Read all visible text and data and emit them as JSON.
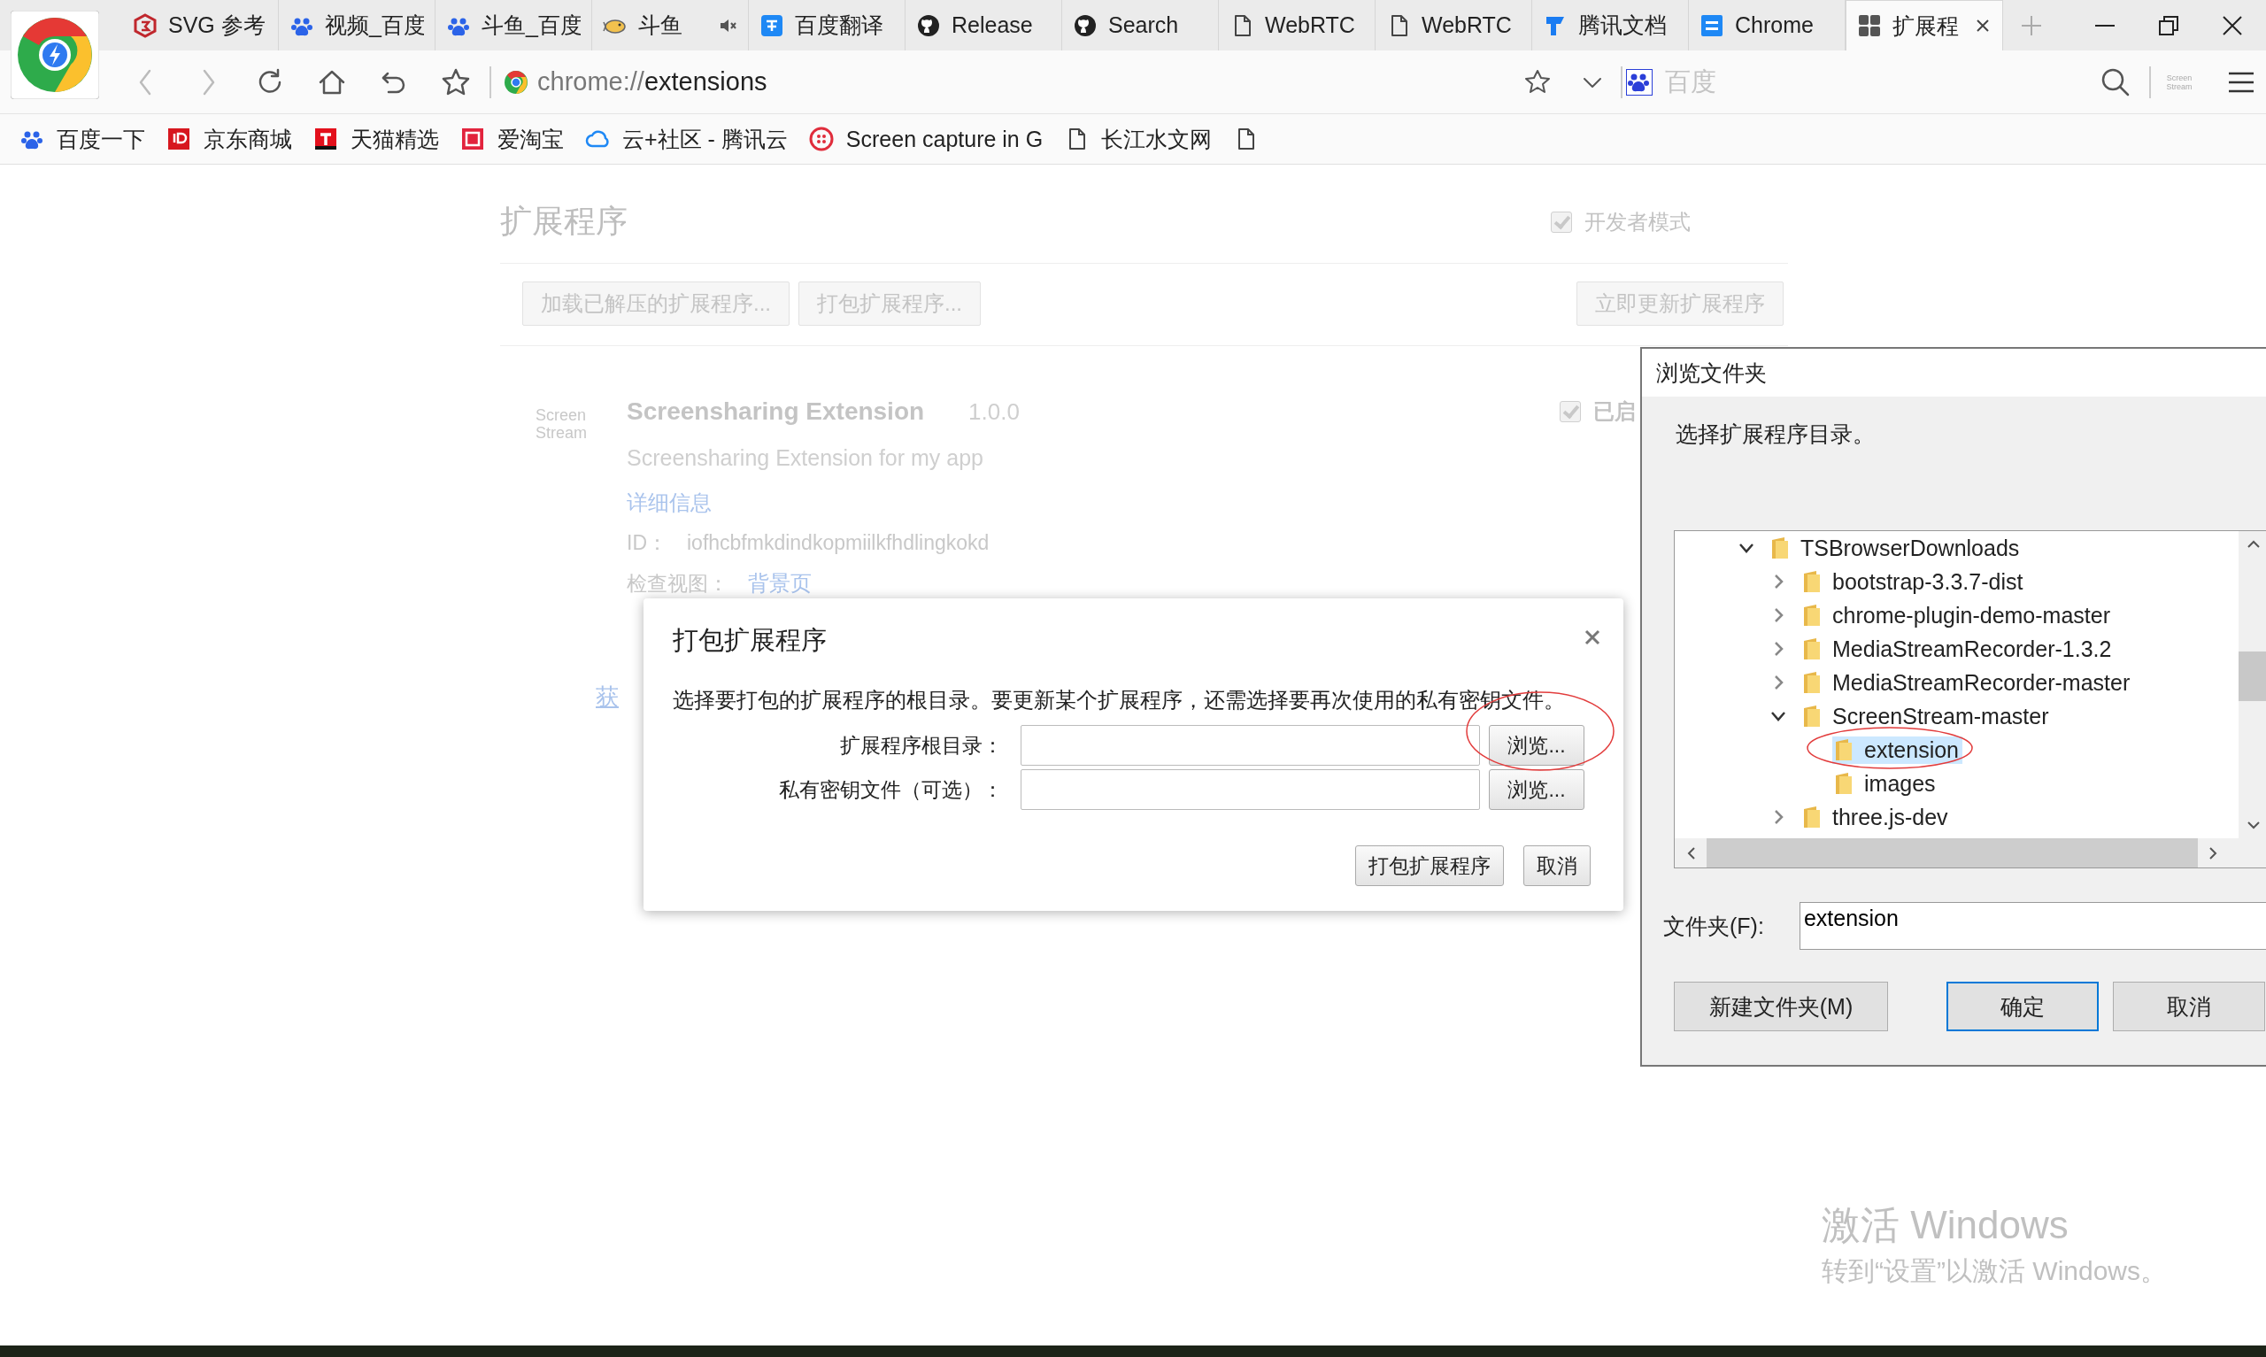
{
  "browser": {
    "tabs": [
      {
        "label": "SVG 参考",
        "selected": false,
        "muted": false
      },
      {
        "label": "视频_百度",
        "selected": false,
        "muted": false
      },
      {
        "label": "斗鱼_百度",
        "selected": false,
        "muted": false
      },
      {
        "label": "斗鱼",
        "selected": false,
        "muted": true
      },
      {
        "label": "百度翻译",
        "selected": false,
        "muted": false
      },
      {
        "label": "Release",
        "selected": false,
        "muted": false
      },
      {
        "label": "Search",
        "selected": false,
        "muted": false
      },
      {
        "label": "WebRTC",
        "selected": false,
        "muted": false
      },
      {
        "label": "WebRTC",
        "selected": false,
        "muted": false
      },
      {
        "label": "腾讯文档",
        "selected": false,
        "muted": false
      },
      {
        "label": "Chrome",
        "selected": false,
        "muted": false
      },
      {
        "label": "扩展程",
        "selected": true,
        "muted": false
      }
    ],
    "address": "chrome://extensions",
    "search": {
      "placeholder": "百度"
    },
    "toolbar_extension": {
      "label": "Screen Stream"
    },
    "bookmarks": [
      "百度一下",
      "京东商城",
      "天猫精选",
      "爱淘宝",
      "云+社区 - 腾讯云",
      "Screen capture in G",
      "长江水文网"
    ]
  },
  "extensions_page": {
    "title": "扩展程序",
    "developer_mode": {
      "label": "开发者模式",
      "checked": true
    },
    "buttons": [
      "加载已解压的扩展程序...",
      "打包扩展程序..."
    ],
    "update_button": "立即更新扩展程序",
    "extensions": [
      {
        "icon_text": "Screen Stream",
        "name": "Screensharing Extension",
        "version": "1.0.0",
        "description": "Screensharing Extension for my app",
        "details_link": "详细信息",
        "id_label": "ID：",
        "id": "iofhcbfmkdindkopmiilkfhdlingkokd",
        "views_label": "检查视图：",
        "views_link": "背景页",
        "enabled": {
          "label": "已启",
          "checked": true
        }
      }
    ],
    "footer_link": "获"
  },
  "pack_dialog": {
    "title": "打包扩展程序",
    "description": "选择要打包的扩展程序的根目录。要更新某个扩展程序，还需选择要再次使用的私有密钥文件。",
    "fields": [
      {
        "label": "扩展程序根目录：",
        "button": "浏览..."
      },
      {
        "label": "私有密钥文件（可选）：",
        "button": "浏览..."
      }
    ],
    "buttons": [
      "打包扩展程序",
      "取消"
    ]
  },
  "folder_dialog": {
    "title": "浏览文件夹",
    "prompt": "选择扩展程序目录。",
    "tree": [
      {
        "label": "TSBrowserDownloads",
        "expanded": true,
        "selected": false,
        "children": [
          {
            "label": "bootstrap-3.3.7-dist",
            "expanded": false,
            "selected": false
          },
          {
            "label": "chrome-plugin-demo-master",
            "expanded": false,
            "selected": false
          },
          {
            "label": "MediaStreamRecorder-1.3.2",
            "expanded": false,
            "selected": false
          },
          {
            "label": "MediaStreamRecorder-master",
            "expanded": false,
            "selected": false
          },
          {
            "label": "ScreenStream-master",
            "expanded": true,
            "selected": false,
            "children": [
              {
                "label": "extension",
                "selected": true
              },
              {
                "label": "images",
                "selected": false
              }
            ]
          },
          {
            "label": "three.js-dev",
            "expanded": false,
            "selected": false
          }
        ]
      }
    ],
    "folder_label": "文件夹(F):",
    "folder_value": "extension",
    "buttons": [
      {
        "label": "新建文件夹(M)",
        "default": false
      },
      {
        "label": "确定",
        "default": true
      },
      {
        "label": "取消",
        "default": false
      }
    ]
  },
  "watermark": {
    "title": "激活 Windows",
    "subtitle": "转到“设置”以激活 Windows。"
  }
}
